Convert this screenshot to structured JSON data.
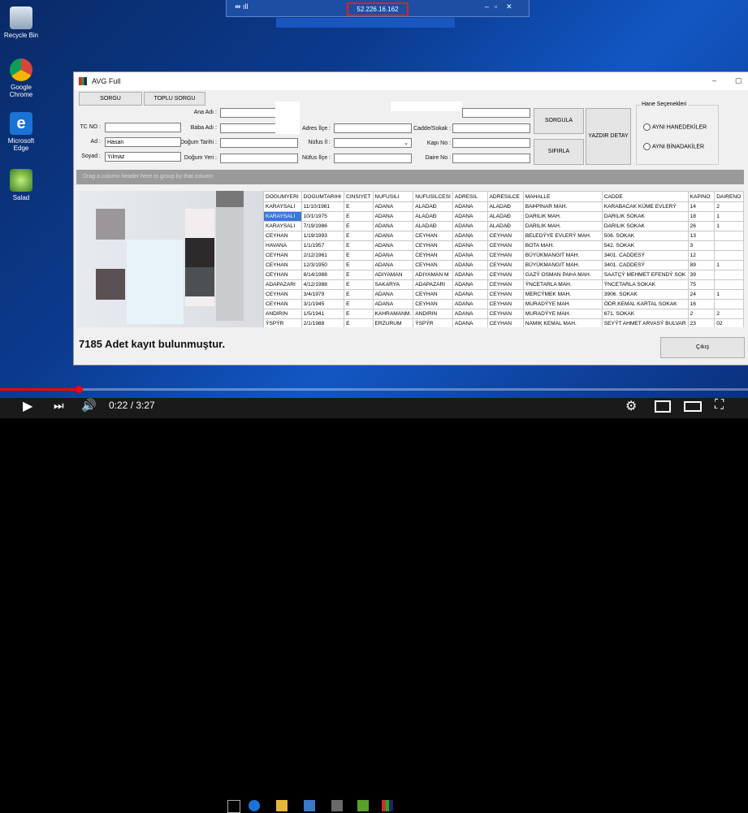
{
  "remote_bar": {
    "ip": "52.226.16.162"
  },
  "desktop_icons": [
    {
      "label": "Recycle Bin"
    },
    {
      "label": "Google Chrome"
    },
    {
      "label": "Microsoft Edge"
    },
    {
      "label": "Salad"
    }
  ],
  "window": {
    "title": "AVG Full"
  },
  "tabs": [
    "SORGU",
    "TOPLU SORGU"
  ],
  "form": {
    "ana_adi_label": "Ana Adı :",
    "baba_adi_label": "Baba Adı :",
    "dogum_tarihi_label": "Doğum Tarihi :",
    "dogum_yeri_label": "Doğum Yeri :",
    "tc_label": "TC NO :",
    "ad_label": "Ad :",
    "ad_value": "Hasan",
    "soyad_label": "Soyad :",
    "soyad_value": "Yılmaz",
    "adres_ilce_label": "Adres İlçe :",
    "nufus_il_label": "Nüfus İl :",
    "nufus_ilce_label": "Nüfus İlçe :",
    "cadde_label": "Cadde/Sokak :",
    "kapi_label": "Kapı No :",
    "daire_label": "Daire No :",
    "sorgula": "SORGULA",
    "sifirla": "SIFIRLA",
    "yazdir": "YAZDIR DETAY",
    "hane_title": "Hane Seçenekleri",
    "hane_opt1": "AYNI HANEDEKİLER",
    "hane_opt2": "AYNI BİNADAKİLER"
  },
  "grid_hint": "Drag a column header here to group by that column",
  "columns": [
    "DOGUMYERI",
    "DOGUMTARIHI",
    "CINSIYET",
    "NUFUSILI",
    "NUFUSILCESI",
    "ADRESIL",
    "ADRESILCE",
    "MAHALLE",
    "CADDE",
    "KAPINO",
    "DAIRENO"
  ],
  "rows": [
    [
      "KARAYSALI",
      "11/10/1981",
      "E",
      "ADANA",
      "ALADAÐ",
      "ADANA",
      "ALADAÐ",
      "BAÞPINAR MAH.",
      "KARABACAK KÜME EVLERÝ",
      "14",
      "2"
    ],
    [
      "KARAYSALI",
      "10/1/1975",
      "E",
      "ADANA",
      "ALADAÐ",
      "ADANA",
      "ALADAÐ",
      "DARILIK MAH.",
      "DARILIK SOKAK",
      "18",
      "1"
    ],
    [
      "KARAYSALI",
      "7/19/1986",
      "E",
      "ADANA",
      "ALADAÐ",
      "ADANA",
      "ALADAÐ",
      "DARILIK MAH.",
      "DARILIK SOKAK",
      "26",
      "1"
    ],
    [
      "CEYHAN",
      "1/19/1993",
      "E",
      "ADANA",
      "CEYHAN",
      "ADANA",
      "CEYHAN",
      "BELEDÝYE EVLERÝ MAH.",
      "506. SOKAK",
      "13",
      ""
    ],
    [
      "HAVANA",
      "1/1/1957",
      "E",
      "ADANA",
      "CEYHAN",
      "ADANA",
      "CEYHAN",
      "BOTA MAH.",
      "542. SOKAK",
      "3",
      ""
    ],
    [
      "CEYHAN",
      "2/12/1961",
      "E",
      "ADANA",
      "CEYHAN",
      "ADANA",
      "CEYHAN",
      "BÜYÜKMANGIT MAH.",
      "3401. CADDESÝ",
      "12",
      ""
    ],
    [
      "CEYHAN",
      "12/3/1950",
      "E",
      "ADANA",
      "CEYHAN",
      "ADANA",
      "CEYHAN",
      "BÜYÜKMANGIT MAH.",
      "3401. CADDESÝ",
      "89",
      "1"
    ],
    [
      "CEYHAN",
      "8/14/1988",
      "E",
      "ADIYAMAN",
      "ADIYAMAN M",
      "ADANA",
      "CEYHAN",
      "GAZÝ OSMAN PAÞA MAH.",
      "SAATÇÝ MEHMET EFENDÝ SOK",
      "39",
      ""
    ],
    [
      "ADAPAZARI",
      "4/12/1988",
      "E",
      "SAKARYA",
      "ADAPAZARI",
      "ADANA",
      "CEYHAN",
      "ÝNCETARLA MAH.",
      "ÝNCETARLA SOKAK",
      "75",
      ""
    ],
    [
      "CEYHAN",
      "3/4/1979",
      "E",
      "ADANA",
      "CEYHAN",
      "ADANA",
      "CEYHAN",
      "MERCÝMEK MAH.",
      "3906. SOKAK",
      "24",
      "1"
    ],
    [
      "CEYHAN",
      "3/1/1945",
      "E",
      "ADANA",
      "CEYHAN",
      "ADANA",
      "CEYHAN",
      "MURADÝYE MAH.",
      "ÖDR.KEMAL KARTAL SOKAK",
      "16",
      ""
    ],
    [
      "ANDIRIN",
      "1/5/1941",
      "E",
      "KAHRAMANM.",
      "ANDIRIN",
      "ADANA",
      "CEYHAN",
      "MURADÝYE MAH.",
      "671. SOKAK",
      "2",
      "2"
    ],
    [
      "ÝSPÝR",
      "2/1/1988",
      "E",
      "ERZURUM",
      "ÝSPÝR",
      "ADANA",
      "CEYHAN",
      "NAMIK KEMAL MAH.",
      "SEYÝT AHMET ARVASÝ BULVAR",
      "23",
      "02"
    ]
  ],
  "count_text": "7185 Adet kayıt bulunmuştur.",
  "exit": "Çıkış",
  "youtube": {
    "time": "0:22 / 3:27",
    "progress": 0.106
  }
}
